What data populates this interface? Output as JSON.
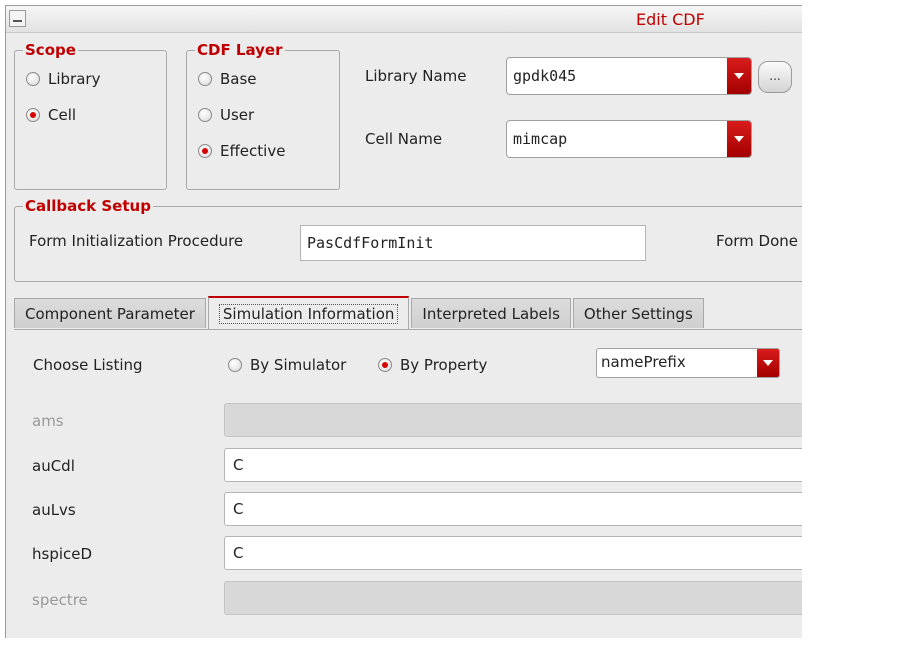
{
  "window": {
    "title": "Edit CDF"
  },
  "scope": {
    "legend": "Scope",
    "options": [
      {
        "label": "Library",
        "selected": false
      },
      {
        "label": "Cell",
        "selected": true
      }
    ]
  },
  "cdf_layer": {
    "legend": "CDF Layer",
    "options": [
      {
        "label": "Base",
        "selected": false
      },
      {
        "label": "User",
        "selected": false
      },
      {
        "label": "Effective",
        "selected": true
      }
    ]
  },
  "library": {
    "label": "Library Name",
    "value": "gpdk045",
    "browse_label": "..."
  },
  "cell": {
    "label": "Cell Name",
    "value": "mimcap"
  },
  "callback": {
    "legend": "Callback Setup",
    "init_label": "Form Initialization Procedure",
    "init_value": "PasCdfFormInit",
    "done_label": "Form Done"
  },
  "tabs": [
    {
      "label": "Component Parameter",
      "active": false
    },
    {
      "label": "Simulation Information",
      "active": true
    },
    {
      "label": "Interpreted Labels",
      "active": false
    },
    {
      "label": "Other Settings",
      "active": false
    }
  ],
  "listing": {
    "label": "Choose Listing",
    "by_simulator": "By Simulator",
    "by_property": "By Property",
    "selected": "By Property",
    "property_value": "namePrefix"
  },
  "properties": [
    {
      "name": "ams",
      "value": "",
      "enabled": false
    },
    {
      "name": "auCdl",
      "value": "C",
      "enabled": true
    },
    {
      "name": "auLvs",
      "value": "C",
      "enabled": true
    },
    {
      "name": "hspiceD",
      "value": "C",
      "enabled": true
    },
    {
      "name": "spectre",
      "value": "",
      "enabled": false
    }
  ],
  "colors": {
    "accent": "#c00000",
    "panel": "#ececec",
    "disabled_field": "#d8d8d8"
  }
}
